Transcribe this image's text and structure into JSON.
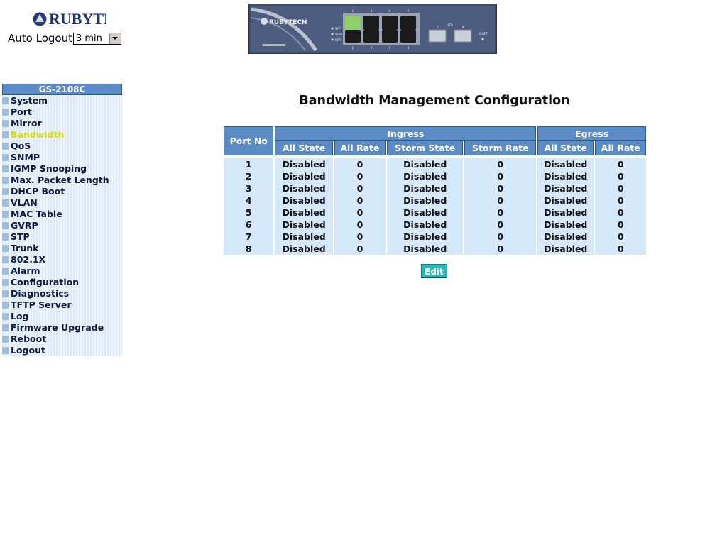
{
  "header": {
    "logo_text": "RUBYTECH",
    "auto_logout_label": "Auto Logout",
    "auto_logout_value": "3 min"
  },
  "device_panel": {
    "brand": "RUBYTECH",
    "port_labels_top": [
      "1",
      "3",
      "5",
      "7"
    ],
    "port_labels_bottom": [
      "2",
      "4",
      "6",
      "8"
    ],
    "leds": [
      "SFP7",
      "SFP8",
      "PWR"
    ],
    "sfp_label": "SFP",
    "sfp_ports": [
      "7",
      "8"
    ],
    "reset_label": "RESET"
  },
  "sidebar": {
    "model": "GS-2108C",
    "items": [
      {
        "label": "System"
      },
      {
        "label": "Port"
      },
      {
        "label": "Mirror"
      },
      {
        "label": "Bandwidth",
        "active": true
      },
      {
        "label": "QoS"
      },
      {
        "label": "SNMP"
      },
      {
        "label": "IGMP Snooping"
      },
      {
        "label": "Max. Packet Length"
      },
      {
        "label": "DHCP Boot"
      },
      {
        "label": "VLAN"
      },
      {
        "label": "MAC Table"
      },
      {
        "label": "GVRP"
      },
      {
        "label": "STP"
      },
      {
        "label": "Trunk"
      },
      {
        "label": "802.1X"
      },
      {
        "label": "Alarm"
      },
      {
        "label": "Configuration"
      },
      {
        "label": "Diagnostics"
      },
      {
        "label": "TFTP Server"
      },
      {
        "label": "Log"
      },
      {
        "label": "Firmware Upgrade"
      },
      {
        "label": "Reboot"
      },
      {
        "label": "Logout"
      }
    ]
  },
  "main": {
    "title": "Bandwidth Management Configuration",
    "table": {
      "port_header": "Port No",
      "group_headers": [
        "Ingress",
        "Egress"
      ],
      "sub_headers": [
        "All State",
        "All Rate",
        "Storm State",
        "Storm Rate",
        "All State",
        "All Rate"
      ],
      "rows": [
        [
          "1",
          "Disabled",
          "0",
          "Disabled",
          "0",
          "Disabled",
          "0"
        ],
        [
          "2",
          "Disabled",
          "0",
          "Disabled",
          "0",
          "Disabled",
          "0"
        ],
        [
          "3",
          "Disabled",
          "0",
          "Disabled",
          "0",
          "Disabled",
          "0"
        ],
        [
          "4",
          "Disabled",
          "0",
          "Disabled",
          "0",
          "Disabled",
          "0"
        ],
        [
          "5",
          "Disabled",
          "0",
          "Disabled",
          "0",
          "Disabled",
          "0"
        ],
        [
          "6",
          "Disabled",
          "0",
          "Disabled",
          "0",
          "Disabled",
          "0"
        ],
        [
          "7",
          "Disabled",
          "0",
          "Disabled",
          "0",
          "Disabled",
          "0"
        ],
        [
          "8",
          "Disabled",
          "0",
          "Disabled",
          "0",
          "Disabled",
          "0"
        ]
      ]
    },
    "edit_label": "Edit"
  },
  "colors": {
    "header_blue": "#5b8cc6",
    "cell_blue": "#d6e9fb",
    "sidebar_active": "#dddd00",
    "edit_button": "#29b6b9",
    "port_active_led": "#8fcf6b"
  }
}
